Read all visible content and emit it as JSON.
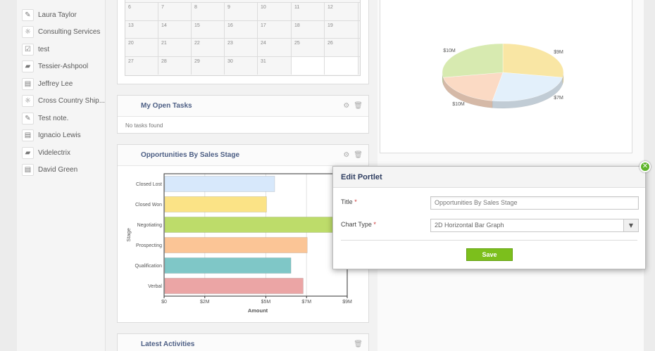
{
  "sidebar": {
    "items": [
      {
        "icon": "pencil-icon",
        "glyph": "✎",
        "label": "Laura Taylor"
      },
      {
        "icon": "lightbulb-icon",
        "glyph": "☼",
        "label": "Consulting Services"
      },
      {
        "icon": "checkbox-icon",
        "glyph": "☑",
        "label": "test"
      },
      {
        "icon": "folder-icon",
        "glyph": "▰",
        "label": "Tessier-Ashpool"
      },
      {
        "icon": "contact-card-icon",
        "glyph": "▤",
        "label": "Jeffrey Lee"
      },
      {
        "icon": "lightbulb-icon",
        "glyph": "☼",
        "label": "Cross Country Ship..."
      },
      {
        "icon": "note-icon",
        "glyph": "✎",
        "label": "Test note."
      },
      {
        "icon": "contact-card-icon",
        "glyph": "▤",
        "label": "Ignacio Lewis"
      },
      {
        "icon": "folder-icon",
        "glyph": "▰",
        "label": "Videlectrix"
      },
      {
        "icon": "contact-card-icon",
        "glyph": "▤",
        "label": "David Green"
      }
    ]
  },
  "calendar": {
    "rows": [
      [
        "6",
        "7",
        "8",
        "9",
        "10",
        "11",
        "12"
      ],
      [
        "13",
        "14",
        "15",
        "16",
        "17",
        "18",
        "19"
      ],
      [
        "20",
        "21",
        "22",
        "23",
        "24",
        "25",
        "26"
      ],
      [
        "27",
        "28",
        "29",
        "30",
        "31",
        "",
        ""
      ]
    ]
  },
  "tasks_panel": {
    "title": "My Open Tasks",
    "empty_text": "No tasks found"
  },
  "opportunities_panel": {
    "title": "Opportunities By Sales Stage"
  },
  "activities_panel": {
    "title": "Latest Activities"
  },
  "icons": {
    "gear": "⚙",
    "trash": "🗑"
  },
  "chart_data": [
    {
      "type": "bar",
      "orientation": "horizontal",
      "categories": [
        "Closed Lost",
        "Closed Won",
        "Negotiating",
        "Prospecting",
        "Qualification",
        "Verbal"
      ],
      "values": [
        5.4,
        5.0,
        9.0,
        7.0,
        6.2,
        6.8
      ],
      "colors": [
        "#d7e8fb",
        "#fbe386",
        "#bddc6a",
        "#fbc596",
        "#7fc7c7",
        "#eba5a5"
      ],
      "xlabel": "Amount",
      "ylabel": "Stage",
      "xlim": [
        0,
        9
      ],
      "x_ticks": [
        0,
        2,
        5,
        7,
        9
      ],
      "x_tick_labels": [
        "$0",
        "$2M",
        "$5M",
        "$7M",
        "$9M"
      ]
    },
    {
      "type": "pie",
      "style": "3d",
      "values": [
        10,
        9,
        7,
        10
      ],
      "slice_labels": [
        "$10M",
        "$9M",
        "$7M",
        "$10M"
      ],
      "colors": [
        "#f9e6a4",
        "#e3f0fb",
        "#fbdac4",
        "#d7eab0"
      ]
    }
  ],
  "modal": {
    "title": "Edit Portlet",
    "title_label": "Title",
    "required_mark": "*",
    "title_value": "Opportunities By Sales Stage",
    "chart_type_label": "Chart Type",
    "chart_type_value": "2D Horizontal Bar Graph",
    "save_label": "Save",
    "close_glyph": "✕",
    "dropdown_glyph": "▼"
  }
}
